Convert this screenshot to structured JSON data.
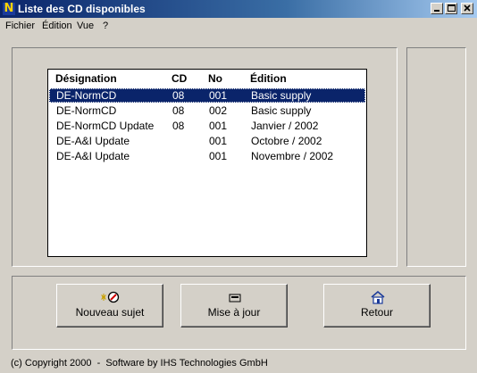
{
  "window": {
    "title": "Liste des CD disponibles"
  },
  "menu": [
    "Fichier",
    "Édition",
    "Vue",
    "?"
  ],
  "list": {
    "headers": [
      "Désignation",
      "CD",
      "No",
      "Édition"
    ],
    "rows": [
      [
        "DE-NormCD",
        "08",
        "001",
        "Basic supply"
      ],
      [
        "DE-NormCD",
        "08",
        "002",
        "Basic supply"
      ],
      [
        "DE-NormCD Update",
        "08",
        "001",
        "Janvier / 2002"
      ],
      [
        "DE-A&I Update",
        "",
        "001",
        "Octobre / 2002"
      ],
      [
        "DE-A&I Update",
        "",
        "001",
        "Novembre / 2002"
      ]
    ],
    "selected_row": 0
  },
  "buttons": {
    "new_subject": "Nouveau sujet",
    "update": "Mise à jour",
    "back": "Retour"
  },
  "status": "(c) Copyright 2000  -  Software by IHS Technologies GmbH",
  "colors": {
    "title_start": "#0a246a",
    "title_end": "#a6caf0",
    "selection": "#0a246a",
    "face": "#d4d0c8"
  }
}
